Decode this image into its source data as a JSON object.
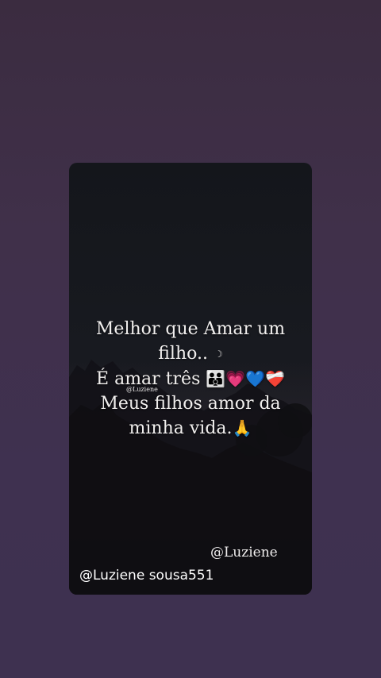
{
  "story": {
    "lines": [
      "Melhor que Amar um",
      "filho..",
      "É amar três",
      "Meus filhos amor da",
      "minha vida."
    ],
    "moon": "☽",
    "emojis_line3": "👪💗💙❤️‍🩹",
    "emoji_line5": "🙏",
    "small_tag": "@Luziene",
    "watermark_right": "@Luziene",
    "watermark_bottom": "@Luziene sousa551"
  },
  "colors": {
    "background": "#3f3150",
    "card": "#17191e",
    "text": "#f1efee"
  }
}
